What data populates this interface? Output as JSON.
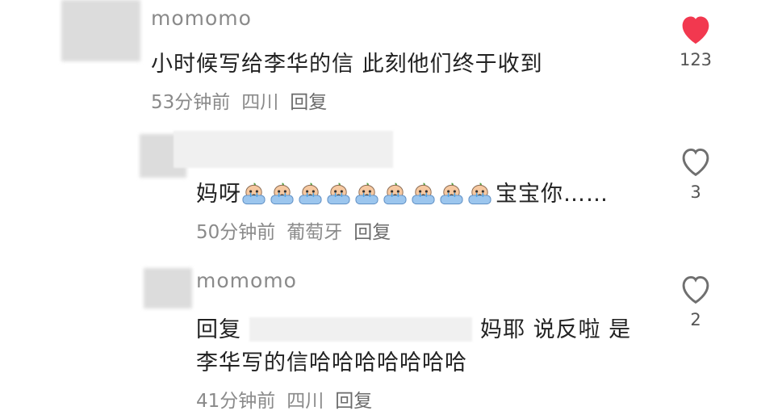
{
  "comments": [
    {
      "username": "momomo",
      "text": "小时候写给李华的信 此刻他们终于收到",
      "time": "53分钟前",
      "location": "四川",
      "reply_label": "回复",
      "likes": "123",
      "liked": true
    },
    {
      "username": "",
      "text_prefix": "妈呀",
      "emoji_count": 9,
      "emoji_icon": "crying-face-emoji",
      "text_suffix": "宝宝你……",
      "time": "50分钟前",
      "location": "葡萄牙",
      "reply_label": "回复",
      "likes": "3",
      "liked": false
    },
    {
      "username": "momomo",
      "reply_prefix": "回复",
      "text_line1": "妈耶 说反啦 是",
      "text_line2": "李华写的信哈哈哈哈哈哈哈",
      "time": "41分钟前",
      "location": "四川",
      "reply_label": "回复",
      "likes": "2",
      "liked": false
    }
  ],
  "colors": {
    "like_active": "#f2384f",
    "like_inactive": "#6f6f6f",
    "meta": "#8a8a8a"
  }
}
